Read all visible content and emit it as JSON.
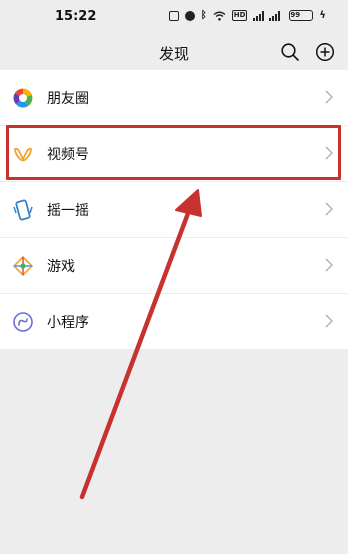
{
  "status_bar": {
    "time": "15:22",
    "battery_level": "99",
    "icons": [
      "nfc-icon",
      "alarm-icon",
      "bluetooth-icon",
      "wifi-icon",
      "hd-icon",
      "signal-icon",
      "battery-icon",
      "charging-icon"
    ]
  },
  "header": {
    "title": "发现",
    "search_icon": "search-icon",
    "add_icon": "add-circle-icon"
  },
  "menu": {
    "items": [
      {
        "label": "朋友圈",
        "icon": "moments-icon"
      },
      {
        "label": "视频号",
        "icon": "channels-icon",
        "highlighted": true
      },
      {
        "label": "摇一摇",
        "icon": "shake-icon"
      },
      {
        "label": "游戏",
        "icon": "games-icon"
      },
      {
        "label": "小程序",
        "icon": "mini-programs-icon"
      }
    ]
  },
  "annotation": {
    "highlight_color": "#c8322e",
    "arrow_color": "#c8322e"
  }
}
